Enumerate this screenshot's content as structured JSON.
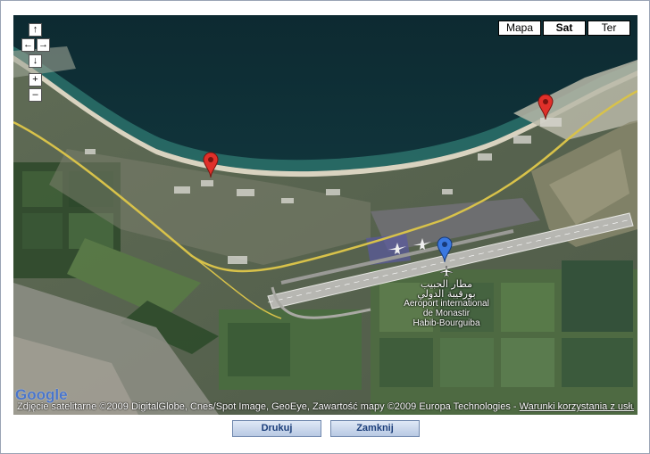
{
  "map": {
    "type_buttons": [
      {
        "label": "Mapa",
        "active": false
      },
      {
        "label": "Sat",
        "active": true
      },
      {
        "label": "Ter",
        "active": false
      }
    ],
    "controls": {
      "pan_up": "↑",
      "pan_left": "←",
      "pan_right": "→",
      "pan_down": "↓",
      "zoom_in": "+",
      "zoom_out": "–"
    },
    "airport_label": {
      "arabic_line1": "مطار الحبيب",
      "arabic_line2": "بورقيبة الدولي",
      "line1": "Aeroport international",
      "line2": "de Monastir",
      "line3": "Habib-Bourguiba"
    },
    "copyright": "Zdjęcie satelitarne ©2009 DigitalGlobe, Cnes/Spot Image, GeoEye, Zawartość mapy ©2009 Europa Technologies - ",
    "terms_link": "Warunki korzystania z usługi",
    "logo": "Google",
    "marker_colors": {
      "red": "#e0302a",
      "blue": "#3a78e0"
    }
  },
  "buttons": {
    "print": "Drukuj",
    "close": "Zamknij"
  }
}
